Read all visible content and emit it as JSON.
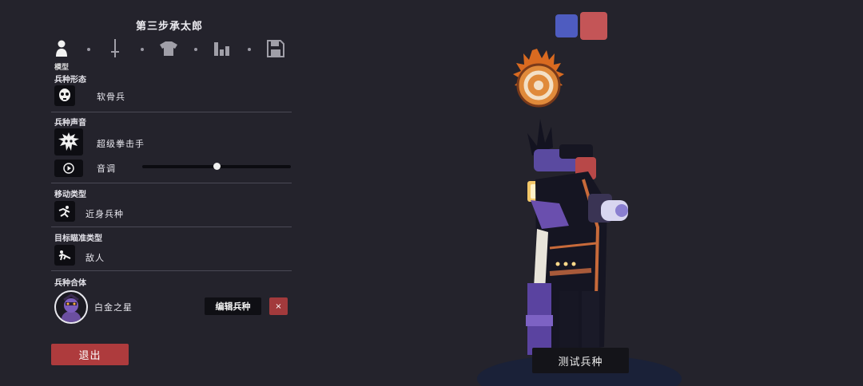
{
  "header": {
    "title": "第三步承太郎"
  },
  "steps": {
    "items": [
      {
        "icon": "person-icon"
      },
      {
        "icon": "sword-icon"
      },
      {
        "icon": "shirt-icon"
      },
      {
        "icon": "stats-icon"
      },
      {
        "icon": "save-icon"
      }
    ],
    "active_caption": "模型"
  },
  "sections": {
    "form": {
      "label": "兵种形态",
      "value": "软骨兵",
      "icon": "skull-mask-icon"
    },
    "voice": {
      "label": "兵种声音",
      "value": "超级拳击手",
      "icon": "boxer-head-icon",
      "pitch_label": "音调",
      "pitch_value": 0.5,
      "play_icon": "play-icon"
    },
    "movement": {
      "label": "移动类型",
      "value": "近身兵种",
      "icon": "run-icon"
    },
    "targeting": {
      "label": "目标瞄准类型",
      "value": "敌人",
      "icon": "target-enemy-icon"
    },
    "merge": {
      "label": "兵种合体",
      "unit_name": "白金之星",
      "edit_label": "编辑兵种",
      "close_label": "×"
    }
  },
  "footer": {
    "exit_label": "退出"
  },
  "scene": {
    "team_colors": [
      "#4e5cc0",
      "#c45557"
    ],
    "test_label": "测试兵种"
  }
}
